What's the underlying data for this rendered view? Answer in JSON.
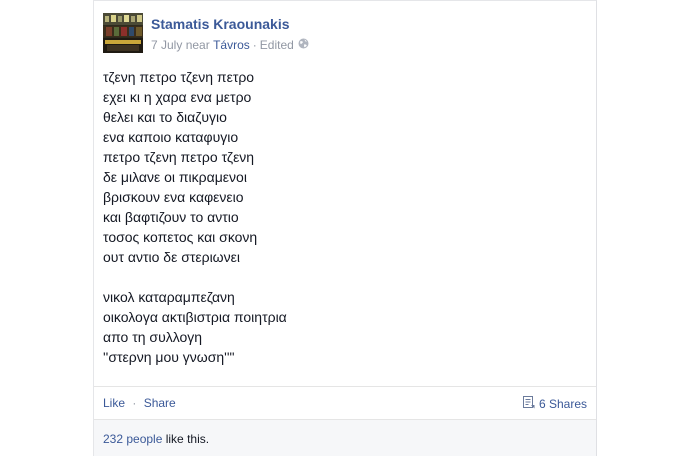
{
  "post": {
    "author": "Stamatis Kraounakis",
    "date": "7 July",
    "near": "near",
    "location": "Távros",
    "separator": "·",
    "edited": "Edited",
    "privacy_icon": "globe-icon",
    "lines": [
      "τζενη πετρο τζενη πετρο",
      "εχει κι η χαρα ενα μετρο",
      "θελει και το διαζυγιο",
      "ενα καποιο καταφυγιο",
      "πετρο τζενη πετρο τζενη",
      "δε μιλανε οι πικραμενοι",
      "βρισκουν ενα καφενειο",
      "και βαφτιζουν το αντιο",
      "τοσος κοπετος και σκονη",
      "ουτ αντιο δε στεριωνει",
      "",
      "νικολ καταραμπεζανη",
      "οικολογα ακτιβιστρια ποιητρια",
      "απο τη συλλογη",
      "''στερνη μου γνωση''\""
    ]
  },
  "actions": {
    "like": "Like",
    "dot": "·",
    "share": "Share",
    "shares_count": "6 Shares",
    "shares_icon": "shares-icon"
  },
  "likes": {
    "count": "232 people",
    "suffix": " like this."
  },
  "colors": {
    "link": "#3b5998",
    "meta": "#9197a3",
    "text": "#141823"
  }
}
